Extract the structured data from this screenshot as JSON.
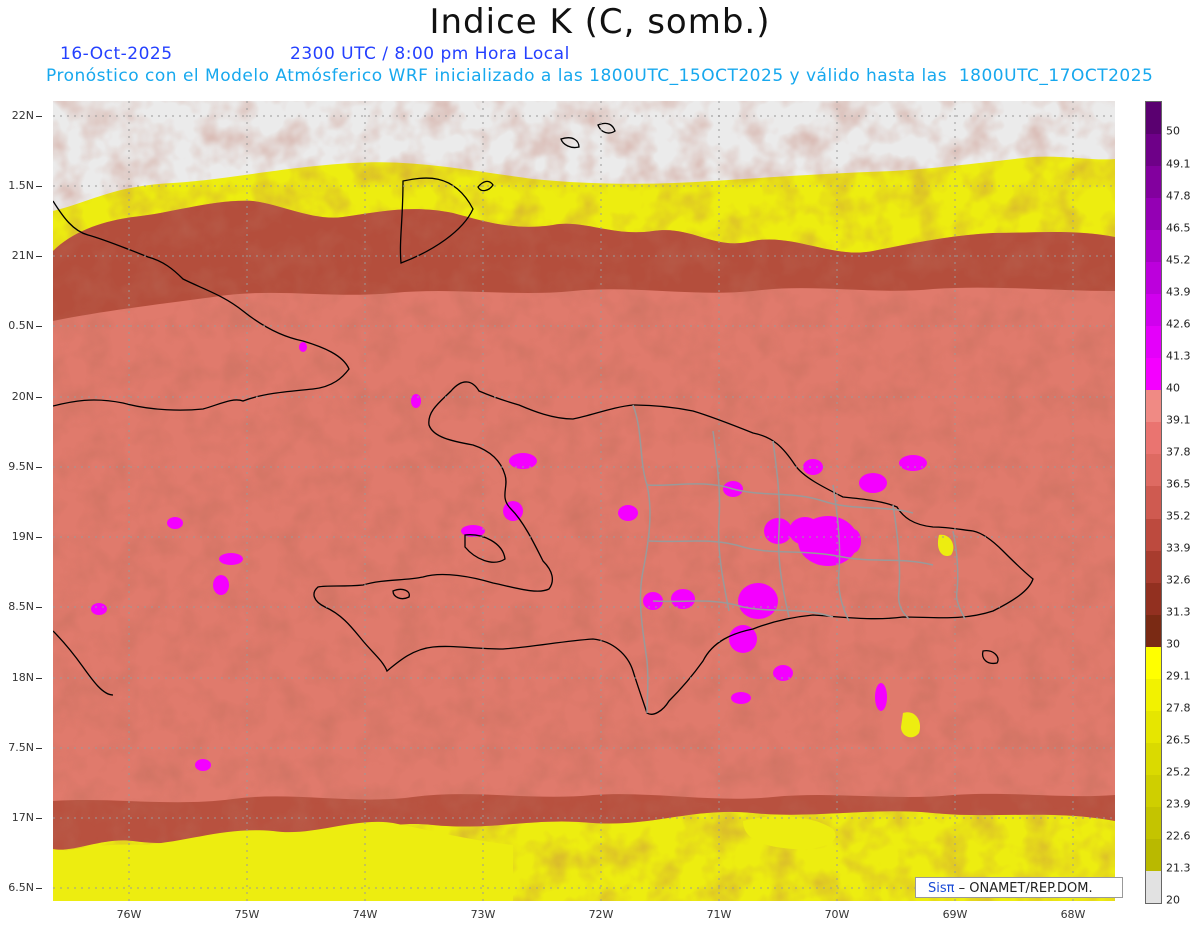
{
  "title": "Indice K (C, somb.)",
  "date": "16-Oct-2025",
  "time": "2300 UTC / 8:00 pm Hora Local",
  "description": "Pronóstico con el Modelo Atmósferico WRF inicializado a las 1800UTC_15OCT2025 y válido hasta las  1800UTC_17OCT2025",
  "lat_labels": [
    "22N",
    "1.5N",
    "21N",
    "0.5N",
    "20N",
    "9.5N",
    "19N",
    "8.5N",
    "18N",
    "7.5N",
    "17N",
    "6.5N"
  ],
  "lon_labels": [
    "76W",
    "75W",
    "74W",
    "73W",
    "72W",
    "71W",
    "70W",
    "69W",
    "68W"
  ],
  "colorbar": {
    "labels": [
      "50",
      "49.1",
      "47.8",
      "46.5",
      "45.2",
      "43.9",
      "42.6",
      "41.3",
      "40",
      "39.1",
      "37.8",
      "36.5",
      "35.2",
      "33.9",
      "32.6",
      "31.3",
      "30",
      "29.1",
      "27.8",
      "26.5",
      "25.2",
      "23.9",
      "22.6",
      "21.3",
      "20"
    ],
    "colors": [
      "#5a0070",
      "#6e0088",
      "#82009e",
      "#9400b4",
      "#a800c8",
      "#bc00dc",
      "#d000ee",
      "#e400fa",
      "#f400ff",
      "#f08a84",
      "#ea7470",
      "#de6a62",
      "#cf5a50",
      "#bd4a3e",
      "#a83c2e",
      "#923020",
      "#7a2a14",
      "#ffff00",
      "#f2f200",
      "#e6e600",
      "#dada00",
      "#cfcf00",
      "#c4c400",
      "#b9b900",
      "#e2e2e2"
    ]
  },
  "credit": {
    "brand": "Sisπ",
    "text": "– ONAMET/REP.DOM."
  }
}
